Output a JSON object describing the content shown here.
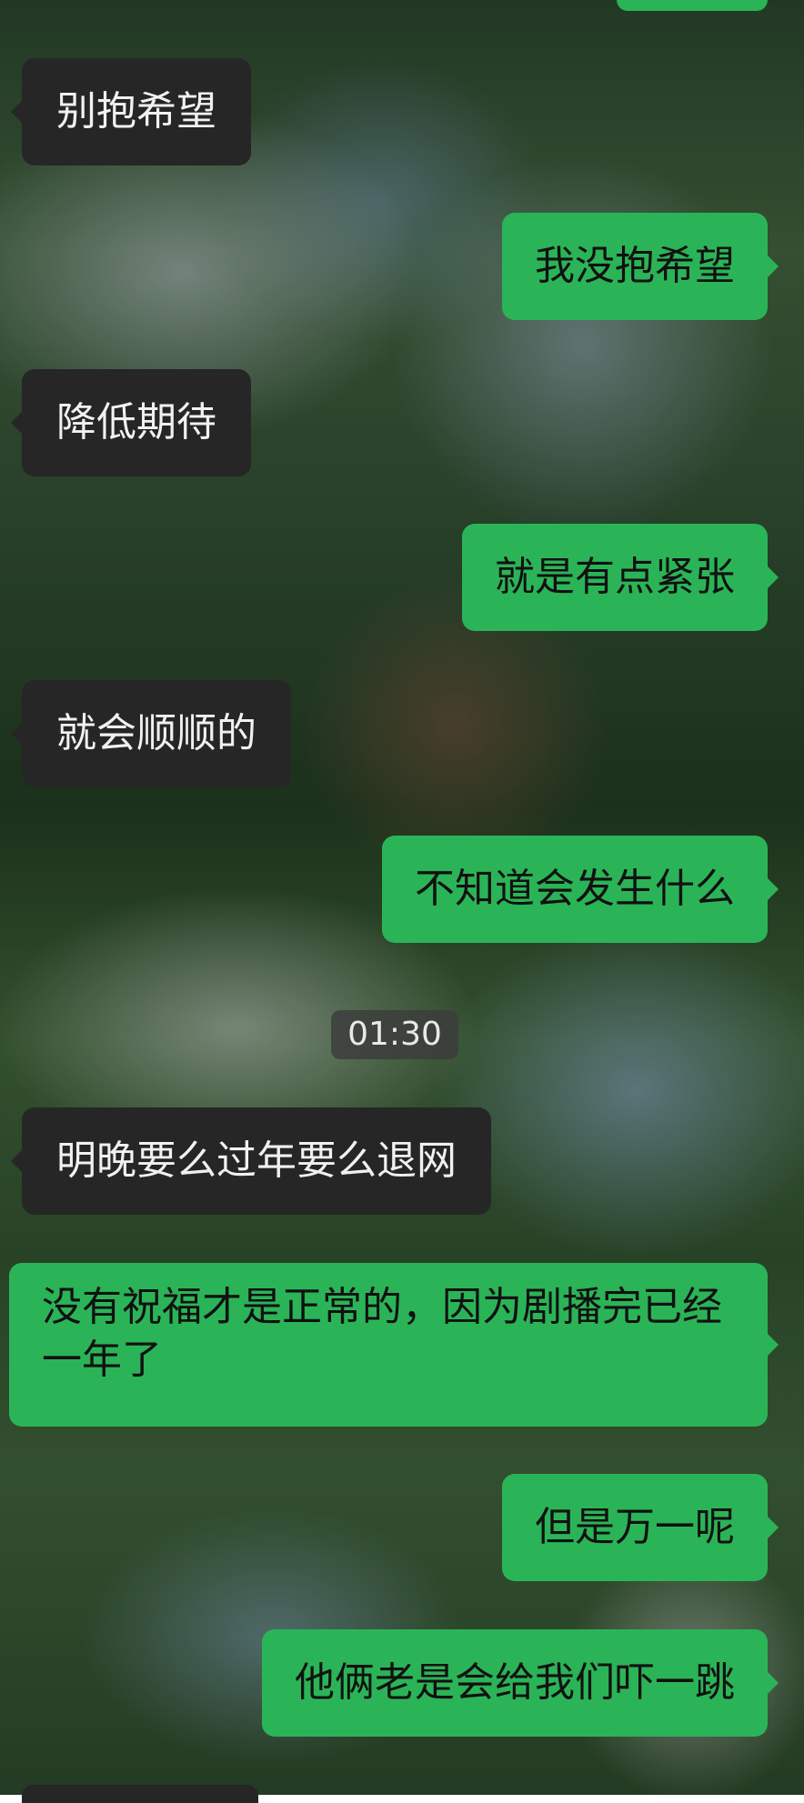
{
  "chat": {
    "messages": [
      {
        "side": "left",
        "text": "别抱希望"
      },
      {
        "side": "right",
        "text": "我没抱希望"
      },
      {
        "side": "left",
        "text": "降低期待"
      },
      {
        "side": "right",
        "text": "就是有点紧张"
      },
      {
        "side": "left",
        "text": "就会顺顺的"
      },
      {
        "side": "right",
        "text": "不知道会发生什么"
      },
      {
        "side": "left",
        "text": "明晚要么过年要么退网"
      },
      {
        "side": "right",
        "text": "没有祝福才是正常的，因为剧播完已经一年了"
      },
      {
        "side": "right",
        "text": "但是万一呢"
      },
      {
        "side": "right",
        "text": "他俩老是会给我们吓一跳"
      }
    ],
    "timestamp": "01:30"
  },
  "colors": {
    "incoming_bubble": "#262626",
    "outgoing_bubble": "#2bb457",
    "incoming_text": "#f1f1f1",
    "outgoing_text": "#111111"
  }
}
